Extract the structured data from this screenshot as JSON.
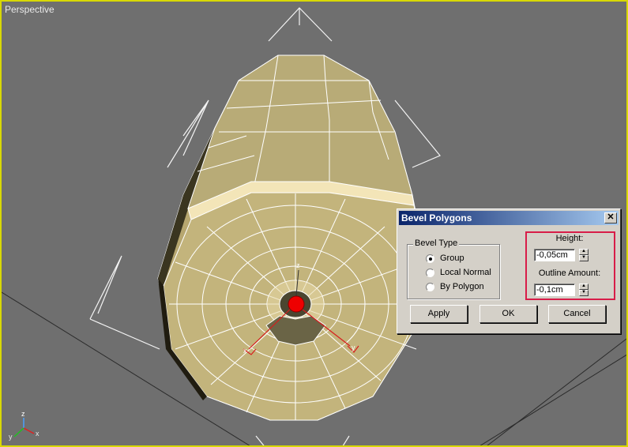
{
  "viewport": {
    "label": "Perspective"
  },
  "axis_gizmo": {
    "z": "z",
    "x": "x",
    "y": "y"
  },
  "transform_gizmo": {
    "x": "x",
    "y": "y",
    "z": "z"
  },
  "dialog": {
    "title": "Bevel Polygons",
    "close_glyph": "✕",
    "bevel_type": {
      "label": "Bevel Type",
      "options": [
        {
          "label": "Group",
          "checked": true
        },
        {
          "label": "Local Normal",
          "checked": false
        },
        {
          "label": "By Polygon",
          "checked": false
        }
      ]
    },
    "height": {
      "label": "Height:",
      "value": "-0,05cm"
    },
    "outline": {
      "label": "Outline Amount:",
      "value": "-0,1cm"
    },
    "buttons": {
      "apply": "Apply",
      "ok": "OK",
      "cancel": "Cancel"
    }
  },
  "colors": {
    "viewport_border": "#d8d800",
    "highlight": "#d81c48",
    "mesh": "#c7b982",
    "selection": "#ee0000"
  },
  "icons": [
    "close-icon",
    "spinner-up-icon",
    "spinner-down-icon",
    "axis-tripod-icon"
  ]
}
